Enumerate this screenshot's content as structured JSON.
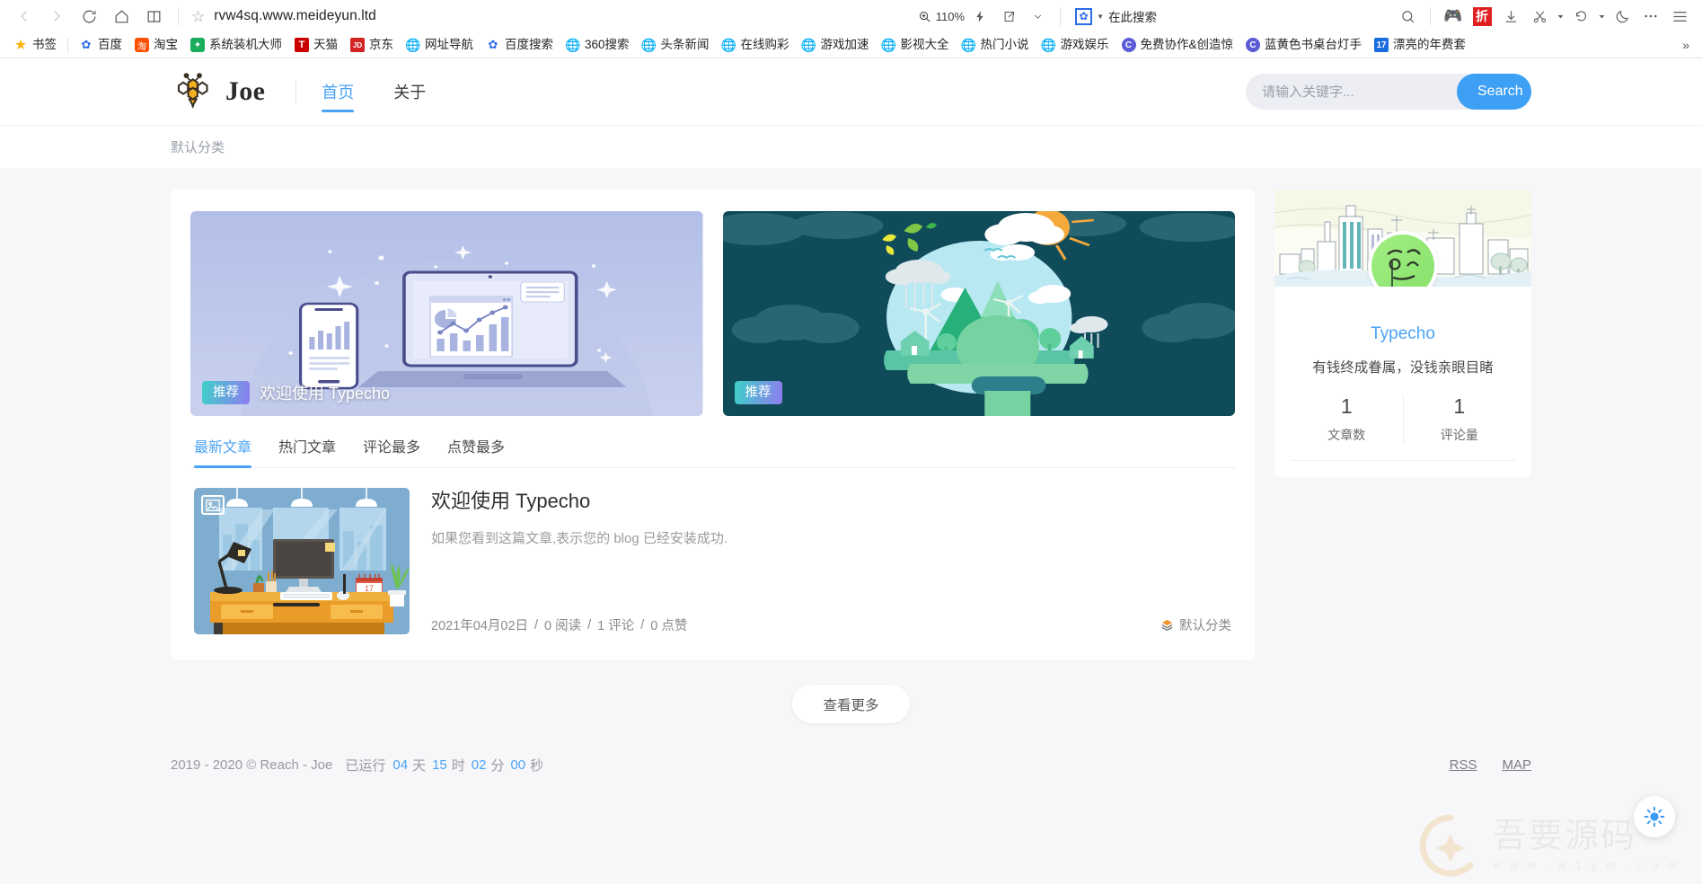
{
  "browser": {
    "url": "rvw4sq.www.meideyun.ltd",
    "zoom_level": "110%",
    "nav": {
      "back": "back-arrow",
      "forward": "forward-arrow",
      "reload": "reload",
      "home": "home",
      "reading": "reading-mode"
    },
    "baidu_search_label": "在此搜索",
    "bookmarks": [
      {
        "label": "书签",
        "icon": "star"
      },
      {
        "label": "百度",
        "icon": "baidu"
      },
      {
        "label": "淘宝",
        "icon": "taobao"
      },
      {
        "label": "系统装机大师",
        "icon": "sys"
      },
      {
        "label": "天猫",
        "icon": "tmall"
      },
      {
        "label": "京东",
        "icon": "jd"
      },
      {
        "label": "网址导航",
        "icon": "globe"
      },
      {
        "label": "百度搜索",
        "icon": "baidu"
      },
      {
        "label": "360搜索",
        "icon": "globe"
      },
      {
        "label": "头条新闻",
        "icon": "globe"
      },
      {
        "label": "在线购彩",
        "icon": "globe"
      },
      {
        "label": "游戏加速",
        "icon": "globe"
      },
      {
        "label": "影视大全",
        "icon": "globe"
      },
      {
        "label": "热门小说",
        "icon": "globe"
      },
      {
        "label": "游戏娱乐",
        "icon": "globe"
      },
      {
        "label": "免费协作&创造惊",
        "icon": "c"
      },
      {
        "label": "蓝黄色书桌台灯手",
        "icon": "c"
      },
      {
        "label": "漂亮的年费套",
        "icon": "blue17"
      }
    ],
    "bookmark_overflow": "»"
  },
  "site": {
    "brand": {
      "name": "Joe",
      "logo": "bee-logo"
    },
    "nav": [
      {
        "label": "首页",
        "active": true
      },
      {
        "label": "关于",
        "active": false
      }
    ],
    "search": {
      "placeholder": "请输入关键字...",
      "value": "",
      "button": "Search"
    },
    "category_bar": {
      "label": "默认分类"
    }
  },
  "featured": [
    {
      "badge": "推荐",
      "title": "欢迎使用 Typecho",
      "art": "devices-chart-illustration"
    },
    {
      "badge": "推荐",
      "title": "",
      "art": "nature-dome-illustration"
    }
  ],
  "tabs": [
    {
      "label": "最新文章",
      "active": true
    },
    {
      "label": "热门文章",
      "active": false
    },
    {
      "label": "评论最多",
      "active": false
    },
    {
      "label": "点赞最多",
      "active": false
    }
  ],
  "posts": [
    {
      "title": "欢迎使用 Typecho",
      "excerpt": "如果您看到这篇文章,表示您的 blog 已经安装成功.",
      "date": "2021年04月02日",
      "reads": "0 阅读",
      "comments": "1 评论",
      "likes": "0 点赞",
      "sep": "/",
      "category": "默认分类",
      "thumb": "desk-workspace-illustration"
    }
  ],
  "more_button": "查看更多",
  "sidebar": {
    "banner": "city-skyline-illustration",
    "avatar": "green-face-avatar",
    "name": "Typecho",
    "motto": "有钱终成眷属，没钱亲眼目睹",
    "stats": [
      {
        "value": "1",
        "label": "文章数"
      },
      {
        "value": "1",
        "label": "评论量"
      }
    ]
  },
  "footer": {
    "copyright": "2019 - 2020 © Reach - Joe",
    "uptime_prefix": "已运行",
    "days": "04",
    "days_unit": "天",
    "hours": "15",
    "hours_unit": "时",
    "minutes": "02",
    "minutes_unit": "分",
    "seconds": "00",
    "seconds_unit": "秒",
    "links": [
      {
        "label": "RSS"
      },
      {
        "label": "MAP"
      }
    ]
  },
  "theme_toggle": {
    "icon": "sun-icon"
  },
  "watermark": {
    "text": "吾要源码",
    "url": "w w w . w 1 y m . c o m"
  },
  "colors": {
    "accent": "#4aa3f5",
    "search_button": "#3da0f5",
    "badge_gradient_from": "#3ed0c8",
    "badge_gradient_to": "#8f7cf0",
    "page_bg": "#f7f7f9"
  }
}
